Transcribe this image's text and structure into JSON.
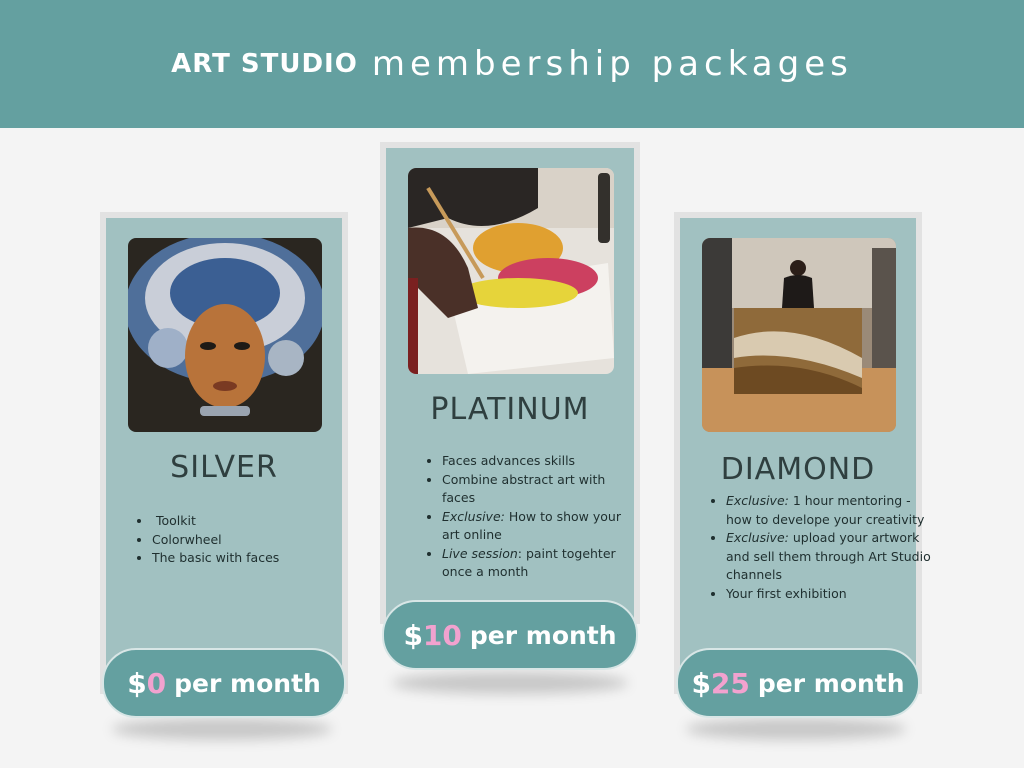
{
  "header": {
    "brand": "ART STUDIO",
    "subtitle": "membership packages"
  },
  "colors": {
    "teal": "#64a0a0",
    "card": "#a1c1c1",
    "pink": "#f2a2cf"
  },
  "packages": [
    {
      "name": "SILVER",
      "features": [
        {
          "plain": "Toolkit"
        },
        {
          "plain": "Colorwheel"
        },
        {
          "plain": "The basic with faces"
        }
      ],
      "price": {
        "currency": "$",
        "amount": "0",
        "period": "per month"
      }
    },
    {
      "name": "PLATINUM",
      "features": [
        {
          "plain": "Faces advances skills"
        },
        {
          "plain": "Combine abstract art with faces"
        },
        {
          "em": "Exclusive:",
          "rest": " How to show your art online"
        },
        {
          "em": "Live session",
          "rest": ": paint togehter once a month"
        }
      ],
      "price": {
        "currency": "$",
        "amount": "10",
        "period": "per month"
      }
    },
    {
      "name": "DIAMOND",
      "features": [
        {
          "em": "Exclusive:",
          "rest": " 1 hour mentoring - how to develope your creativity"
        },
        {
          "em": "Exclusive:",
          "rest": " upload your artwork and sell them through Art Studio channels"
        },
        {
          "plain": "Your first exhibition"
        }
      ],
      "price": {
        "currency": "$",
        "amount": "25",
        "period": "per month"
      }
    }
  ]
}
